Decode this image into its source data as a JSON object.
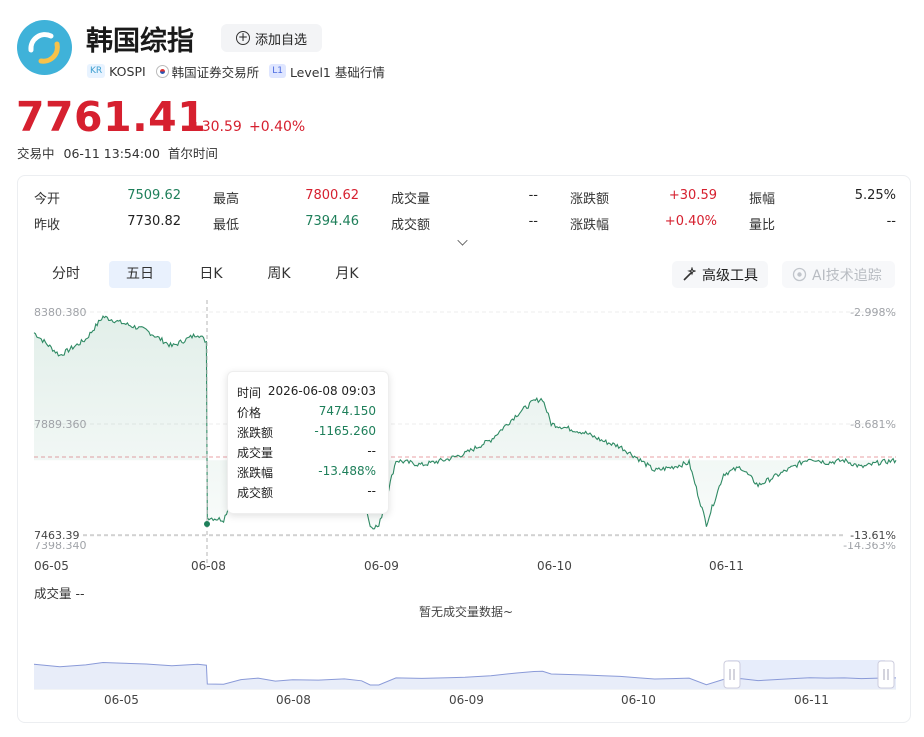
{
  "header": {
    "title": "韩国综指",
    "add_button_label": "添加自选",
    "add_button_icon": "plus-circle-icon",
    "market_tag": "KR",
    "code": "KOSPI",
    "exchange": "韩国证券交易所",
    "level_tag": "L1",
    "level": "Level1 基础行情"
  },
  "quote": {
    "price": "7761.41",
    "change": "+30.59",
    "change_pct": "+0.40%",
    "status": "交易中",
    "time": "06-11 13:54:00",
    "timezone": "首尔时间"
  },
  "stats": [
    {
      "label": "今开",
      "value": "7509.62",
      "color": "#1e7f5a"
    },
    {
      "label": "最高",
      "value": "7800.62",
      "color": "#d6202f"
    },
    {
      "label": "成交量",
      "value": "--",
      "color": "#222222"
    },
    {
      "label": "涨跌额",
      "value": "+30.59",
      "color": "#d6202f"
    },
    {
      "label": "振幅",
      "value": "5.25%",
      "color": "#222222"
    },
    {
      "label": "昨收",
      "value": "7730.82",
      "color": "#222222"
    },
    {
      "label": "最低",
      "value": "7394.46",
      "color": "#1e7f5a"
    },
    {
      "label": "成交额",
      "value": "--",
      "color": "#222222"
    },
    {
      "label": "涨跌幅",
      "value": "+0.40%",
      "color": "#d6202f"
    },
    {
      "label": "量比",
      "value": "--",
      "color": "#222222"
    }
  ],
  "tabs": [
    "分时",
    "五日",
    "日K",
    "周K",
    "月K"
  ],
  "active_tab": "五日",
  "tools": {
    "advanced": "高级工具",
    "advanced_icon": "wand-icon",
    "ai": "AI技术追踪",
    "ai_icon": "ai-icon"
  },
  "axis": {
    "left_top": "8380.380",
    "left_mid": "7889.360",
    "left_bottom": "7398.340",
    "right_top": "-2.998%",
    "right_mid": "-8.681%",
    "right_bottom": "-14.363%",
    "crosshair_price": "7463.39",
    "crosshair_pct": "-13.61%"
  },
  "dates": [
    "06-05",
    "06-08",
    "06-09",
    "06-10",
    "06-11"
  ],
  "tooltip": {
    "rows": [
      {
        "label": "时间",
        "value": "2026-06-08 09:03"
      },
      {
        "label": "价格",
        "value": "7474.150"
      },
      {
        "label": "涨跌额",
        "value": "-1165.260"
      },
      {
        "label": "成交量",
        "value": "--"
      },
      {
        "label": "涨跌幅",
        "value": "-13.488%"
      },
      {
        "label": "成交额",
        "value": "--"
      }
    ]
  },
  "volume": {
    "label": "成交量 --",
    "empty": "暂无成交量数据~"
  },
  "navigator_dates": [
    "06-05",
    "06-08",
    "06-09",
    "06-10",
    "06-11"
  ],
  "colors": {
    "up": "#d6202f",
    "down": "#1e7f5a",
    "line": "#2f8a64",
    "accent": "#3fb2d9"
  },
  "chart_data": {
    "type": "line",
    "title": "",
    "categories": [
      "06-05",
      "06-08",
      "06-09",
      "06-10",
      "06-11"
    ],
    "x_unit": "5-day intraday",
    "ylim": [
      7398.34,
      8380.38
    ],
    "reference_close": 7730.82,
    "series": [
      {
        "name": "",
        "points": [
          [
            0.0,
            8290
          ],
          [
            0.03,
            8190
          ],
          [
            0.06,
            8260
          ],
          [
            0.08,
            8360
          ],
          [
            0.1,
            8335
          ],
          [
            0.13,
            8300
          ],
          [
            0.16,
            8230
          ],
          [
            0.19,
            8285
          ],
          [
            0.2,
            8250
          ],
          [
            0.201,
            7480
          ],
          [
            0.22,
            7470
          ],
          [
            0.24,
            7660
          ],
          [
            0.26,
            7720
          ],
          [
            0.28,
            7600
          ],
          [
            0.3,
            7650
          ],
          [
            0.33,
            7640
          ],
          [
            0.36,
            7690
          ],
          [
            0.38,
            7610
          ],
          [
            0.39,
            7440
          ],
          [
            0.4,
            7440
          ],
          [
            0.42,
            7730
          ],
          [
            0.45,
            7710
          ],
          [
            0.48,
            7735
          ],
          [
            0.5,
            7760
          ],
          [
            0.53,
            7820
          ],
          [
            0.56,
            7930
          ],
          [
            0.58,
            7990
          ],
          [
            0.59,
            8000
          ],
          [
            0.6,
            7890
          ],
          [
            0.62,
            7870
          ],
          [
            0.64,
            7850
          ],
          [
            0.66,
            7815
          ],
          [
            0.68,
            7790
          ],
          [
            0.7,
            7740
          ],
          [
            0.72,
            7685
          ],
          [
            0.74,
            7700
          ],
          [
            0.76,
            7720
          ],
          [
            0.78,
            7450
          ],
          [
            0.8,
            7670
          ],
          [
            0.82,
            7700
          ],
          [
            0.84,
            7620
          ],
          [
            0.86,
            7660
          ],
          [
            0.88,
            7700
          ],
          [
            0.9,
            7740
          ],
          [
            0.92,
            7720
          ],
          [
            0.94,
            7730
          ],
          [
            0.96,
            7700
          ],
          [
            0.98,
            7720
          ],
          [
            1.0,
            7730
          ]
        ]
      }
    ]
  }
}
